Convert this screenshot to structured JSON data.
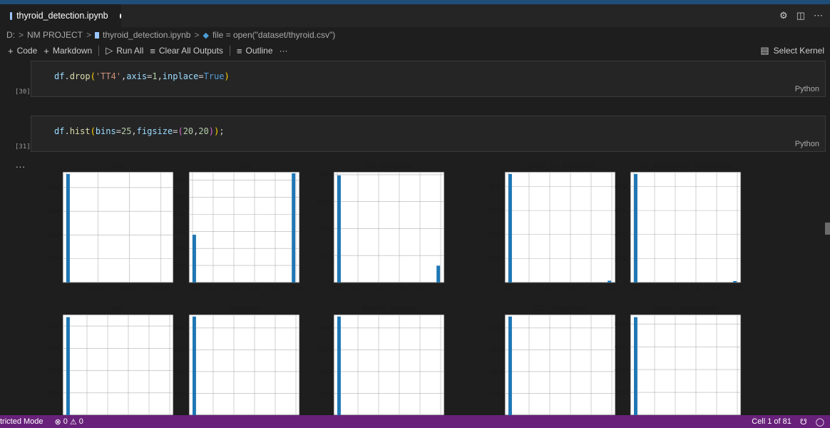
{
  "tab": {
    "title": "thyroid_detection.ipynb"
  },
  "tab_actions": {
    "settings_icon": "⚙",
    "split_icon": "◫",
    "more_icon": "⋯"
  },
  "breadcrumb": {
    "drive": "D:",
    "folder": "NM PROJECT",
    "file": "thyroid_detection.ipynb",
    "symbol": "file = open(\"dataset/thyroid.csv\")",
    "sep": ">"
  },
  "toolbar": {
    "code": "Code",
    "markdown": "Markdown",
    "run_all": "Run All",
    "clear_outputs": "Clear All Outputs",
    "outline": "Outline",
    "more": "···",
    "select_kernel": "Select Kernel"
  },
  "cells": [
    {
      "exec": "[30]",
      "code": "df.drop('TT4',axis=1,inplace=True)",
      "lang": "Python"
    },
    {
      "exec": "[31]",
      "code": "df.hist(bins=25,figsize=(20,20));",
      "lang": "Python"
    }
  ],
  "output": {
    "more": "..."
  },
  "chart_data": [
    {
      "type": "bar",
      "title": "age",
      "xticks": [
        "0",
        "20000",
        "40000",
        "60000"
      ],
      "yticks": [
        "0",
        "2000",
        "4000",
        "6000",
        "8000"
      ],
      "xlim": [
        0,
        65536
      ],
      "ylim": [
        0,
        9200
      ],
      "bars": [
        {
          "x": 0,
          "value": 9150
        }
      ]
    },
    {
      "type": "bar",
      "title": "sex",
      "xticks": [
        "1.0",
        "1.2",
        "1.4",
        "1.6",
        "1.8",
        "2.0"
      ],
      "yticks": [
        "0",
        "1000",
        "2000",
        "3000",
        "4000",
        "5000",
        "6000"
      ],
      "xlim": [
        1.0,
        2.0
      ],
      "ylim": [
        0,
        6400
      ],
      "bars": [
        {
          "x": 1.0,
          "value": 2800
        },
        {
          "x": 2.0,
          "value": 6400
        }
      ]
    },
    {
      "type": "bar",
      "title": "on_thyroxine",
      "xticks": [
        "0.0",
        "0.2",
        "0.4",
        "0.6",
        "0.8",
        "1.0"
      ],
      "yticks": [
        "0",
        "2000",
        "4000",
        "6000",
        "8000"
      ],
      "xlim": [
        0,
        1.0
      ],
      "ylim": [
        0,
        8100
      ],
      "bars": [
        {
          "x": 0.0,
          "value": 7950
        },
        {
          "x": 1.0,
          "value": 1250
        }
      ]
    },
    {
      "type": "bar",
      "title": "query_on_thyroxine",
      "xticks": [
        "0.0",
        "0.2",
        "0.4",
        "0.6",
        "0.8",
        "1.0"
      ],
      "yticks": [
        "0",
        "2000",
        "4000",
        "6000",
        "8000"
      ],
      "xlim": [
        0,
        1.0
      ],
      "ylim": [
        0,
        9100
      ],
      "bars": [
        {
          "x": 0.0,
          "value": 9050
        },
        {
          "x": 1.0,
          "value": 150
        }
      ]
    },
    {
      "type": "bar",
      "title": "on_antithyroid_medication",
      "xticks": [
        "0.0",
        "0.2",
        "0.4",
        "0.6",
        "0.8",
        "1.0"
      ],
      "yticks": [
        "0",
        "2000",
        "4000",
        "6000",
        "8000"
      ],
      "xlim": [
        0,
        1.0
      ],
      "ylim": [
        0,
        9100
      ],
      "bars": [
        {
          "x": 0.0,
          "value": 9050
        },
        {
          "x": 1.0,
          "value": 120
        }
      ]
    },
    {
      "type": "bar",
      "title": "sick",
      "xticks": [],
      "yticks": [
        "2000",
        "4000",
        "6000",
        "8000"
      ],
      "xlim": [
        0,
        1.0
      ],
      "ylim": [
        0,
        8900
      ],
      "bars": [
        {
          "x": 0.0,
          "value": 8800
        }
      ]
    },
    {
      "type": "bar",
      "title": "pregnant",
      "xticks": [],
      "yticks": [
        "2000",
        "4000",
        "6000",
        "8000"
      ],
      "xlim": [
        0,
        1.0
      ],
      "ylim": [
        0,
        9100
      ],
      "bars": [
        {
          "x": 0.0,
          "value": 9050
        }
      ]
    },
    {
      "type": "bar",
      "title": "thyroid_surgery",
      "xticks": [],
      "yticks": [
        "2000",
        "4000",
        "6000",
        "8000"
      ],
      "xlim": [
        0,
        1.0
      ],
      "ylim": [
        0,
        9100
      ],
      "bars": [
        {
          "x": 0.0,
          "value": 9050
        }
      ]
    },
    {
      "type": "bar",
      "title": "I131_treatment",
      "xticks": [],
      "yticks": [
        "2000",
        "4000",
        "6000",
        "8000"
      ],
      "xlim": [
        0,
        1.0
      ],
      "ylim": [
        0,
        9100
      ],
      "bars": [
        {
          "x": 0.0,
          "value": 9050
        }
      ]
    },
    {
      "type": "bar",
      "title": "query_hypothyroid",
      "xticks": [],
      "yticks": [
        "2000",
        "4000",
        "6000",
        "8000"
      ],
      "xlim": [
        0,
        1.0
      ],
      "ylim": [
        0,
        8700
      ],
      "bars": [
        {
          "x": 0.0,
          "value": 8600
        }
      ]
    }
  ],
  "status": {
    "mode": "tricted Mode",
    "errors": "0",
    "warnings": "0",
    "cell_position": "Cell 1 of 81"
  },
  "colors": {
    "bar": "#1f77b4",
    "status_bar": "#68217a",
    "background": "#1e1e1e"
  }
}
